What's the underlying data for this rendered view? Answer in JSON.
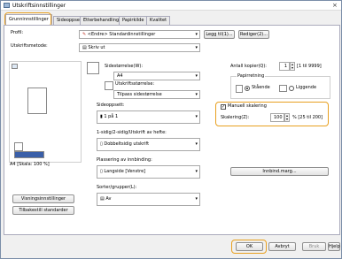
{
  "window": {
    "title": "Utskriftsinnstillinger",
    "close": "×"
  },
  "tabs": [
    "Grunninnstillinger",
    "Sideoppsett",
    "Etterbehandling",
    "Papirkilde",
    "Kvalitet"
  ],
  "profile": {
    "label": "Profil:",
    "value": "<Endre> Standardinnstillinger",
    "add_button": "Legg til(1)...",
    "edit_button": "Rediger(2)..."
  },
  "output_method": {
    "label": "Utskriftsmetode:",
    "value": "Skriv ut"
  },
  "page_size": {
    "label": "Sidestørrelse(W):",
    "value": "A4"
  },
  "output_size": {
    "label": "Utskriftsstørrelse:",
    "value": "Tilpass sidestørrelse"
  },
  "copies": {
    "label": "Antall kopier(Q):",
    "value": "1",
    "range": "[1 til 9999]"
  },
  "orientation": {
    "label": "Papirretning",
    "portrait": "Stående",
    "landscape": "Liggende"
  },
  "page_layout": {
    "label": "Sideoppsett:",
    "value": "1 på 1"
  },
  "manual_scaling": {
    "label": "Manuell skalering",
    "checked": "✓"
  },
  "scaling": {
    "label": "Skalering(Z):",
    "value": "100",
    "unit": "% [25 til 200]"
  },
  "duplex": {
    "label": "1-sidig/2-sidig/Utskrift av hefte:",
    "value": "Dobbeltsidig utskrift"
  },
  "binding": {
    "label": "Plassering av innbinding:",
    "value": "Langside [Venstre]",
    "margin_button": "Innbind.marg..."
  },
  "sorter": {
    "label": "Sorter/grupper(L):",
    "value": "Av"
  },
  "preview": {
    "caption": "A4 [Skala: 100 %]",
    "view_button": "Visningsinnstillinger",
    "restore_button": "Tilbakestill standarder"
  },
  "footer": {
    "ok": "OK",
    "cancel": "Avbryt",
    "apply": "Bruk",
    "help": "Hjelp"
  },
  "colors": {
    "highlight": "#e8a020",
    "accent": "#2a5caa"
  }
}
